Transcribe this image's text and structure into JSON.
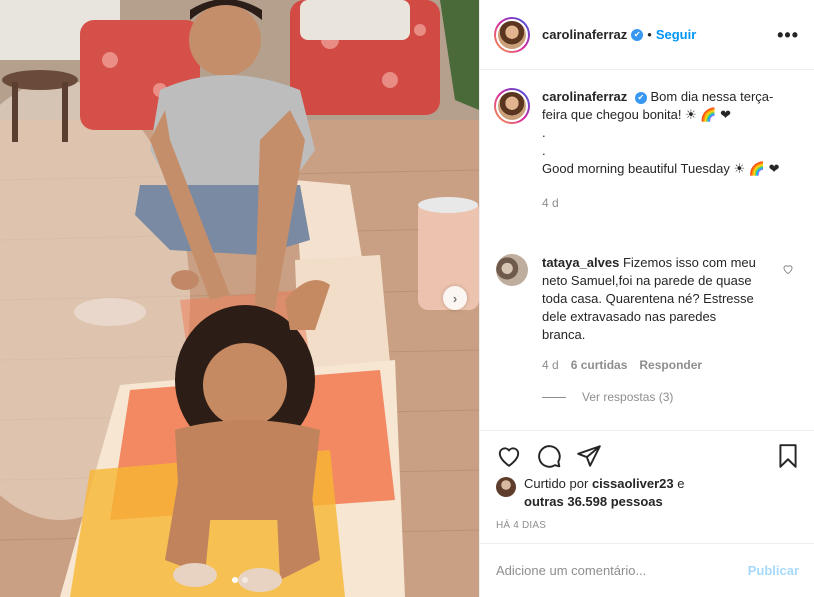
{
  "post": {
    "photo_alt": "",
    "carousel": {
      "total": 2,
      "current": 1
    }
  },
  "header": {
    "username": "carolinaferraz",
    "verified_mark": "✔",
    "follow_sep": "•",
    "follow_label": "Seguir",
    "more_label": "•••"
  },
  "caption": {
    "username": "carolinaferraz",
    "text1": "Bom dia nessa terça-feira que chegou bonita! ☀ 🌈 ❤",
    "dot1": ".",
    "dot2": ".",
    "text2": "Good morning beautiful Tuesday ☀ 🌈 ❤",
    "time": "4 d"
  },
  "comment": {
    "username": "tataya_alves",
    "text": "Fizemos isso com meu neto Samuel,foi na parede de quase toda casa. Quarentena né? Estresse dele extravasado nas paredes branca.",
    "time": "4 d",
    "likes": "6 curtidas",
    "reply": "Responder",
    "view_replies": "Ver respostas (3)"
  },
  "likes": {
    "prefix": "Curtido por",
    "user": "cissaoliver23",
    "conj": "e",
    "others": "outras 36.598 pessoas"
  },
  "date": "HÁ 4 DIAS",
  "add_comment": {
    "placeholder": "Adicione um comentário...",
    "publish": "Publicar"
  },
  "colors": {
    "accent": "#0095f6",
    "verified": "#3897f0",
    "muted": "#8e8e8e",
    "border": "#efefef"
  }
}
